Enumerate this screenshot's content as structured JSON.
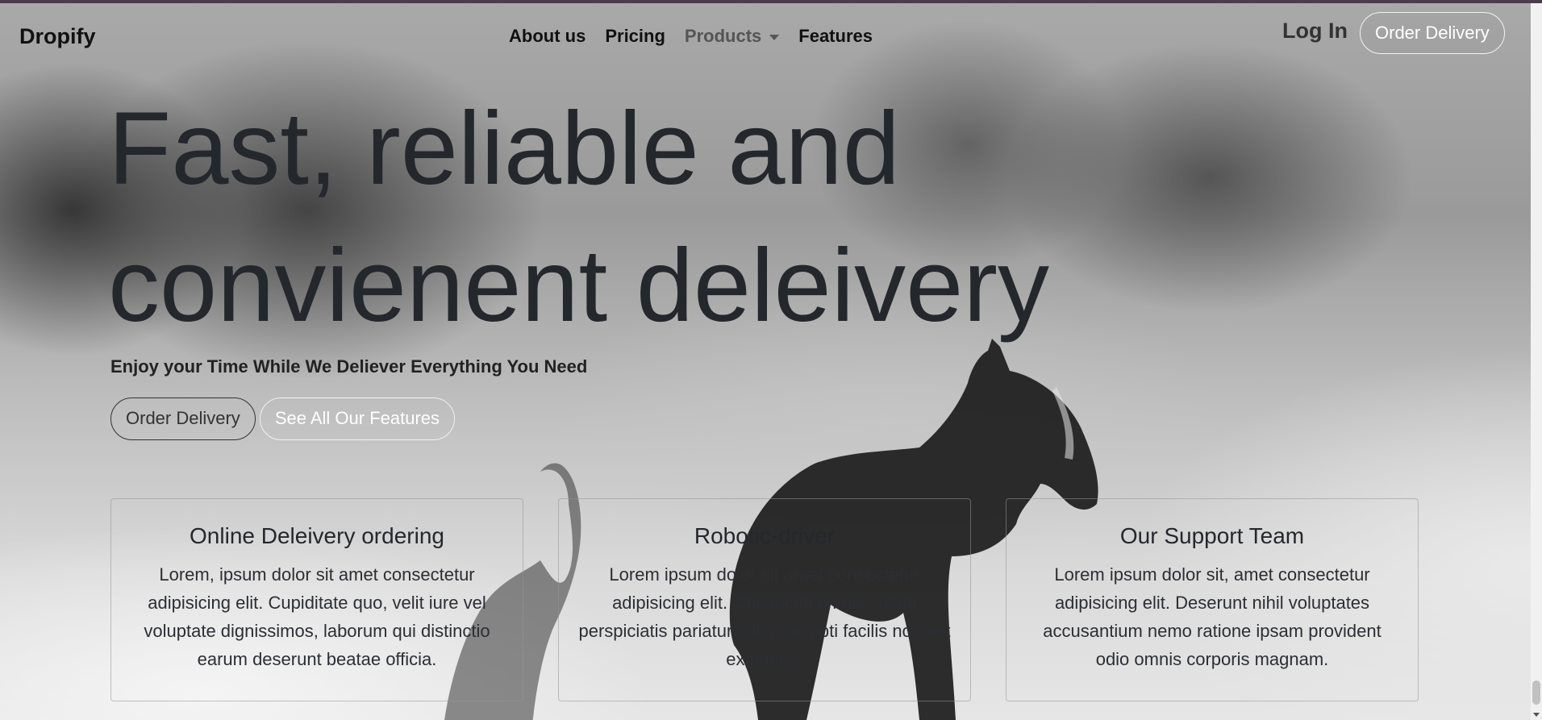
{
  "brand": "Dropify",
  "nav": {
    "items": [
      {
        "label": "About us"
      },
      {
        "label": "Pricing"
      },
      {
        "label": "Products"
      },
      {
        "label": "Features"
      }
    ],
    "login_label": "Log In",
    "order_label": "Order Delivery"
  },
  "hero": {
    "title_line1": "Fast, reliable and",
    "title_line2": "convienent deleivery",
    "subtitle": "Enjoy your Time While We Deliever Everything You Need",
    "primary_button": "Order Delivery",
    "secondary_button": "See All Our Features"
  },
  "cards": [
    {
      "title": "Online Deleivery ordering",
      "text": "Lorem, ipsum dolor sit amet consectetur adipisicing elit. Cupiditate quo, velit iure vel voluptate dignissimos, laborum qui distinctio earum deserunt beatae officia."
    },
    {
      "title": "Robotic-driver",
      "text": "Lorem ipsum dolor sit amet consectetur adipisicing elit. Obcaecati omnis soluta perspiciatis pariatur culla corrupti facilis non est ex natus?"
    },
    {
      "title": "Our Support Team",
      "text": "Lorem ipsum dolor sit, amet consectetur adipisicing elit. Deserunt nihil voluptates accusantium nemo ratione ipsam provident odio omnis corporis magnam."
    }
  ],
  "colors": {
    "text_dark": "#24272c",
    "button_light_border": "#f0f0f0"
  },
  "icons": {
    "products_dropdown": "chevron-down-icon"
  }
}
